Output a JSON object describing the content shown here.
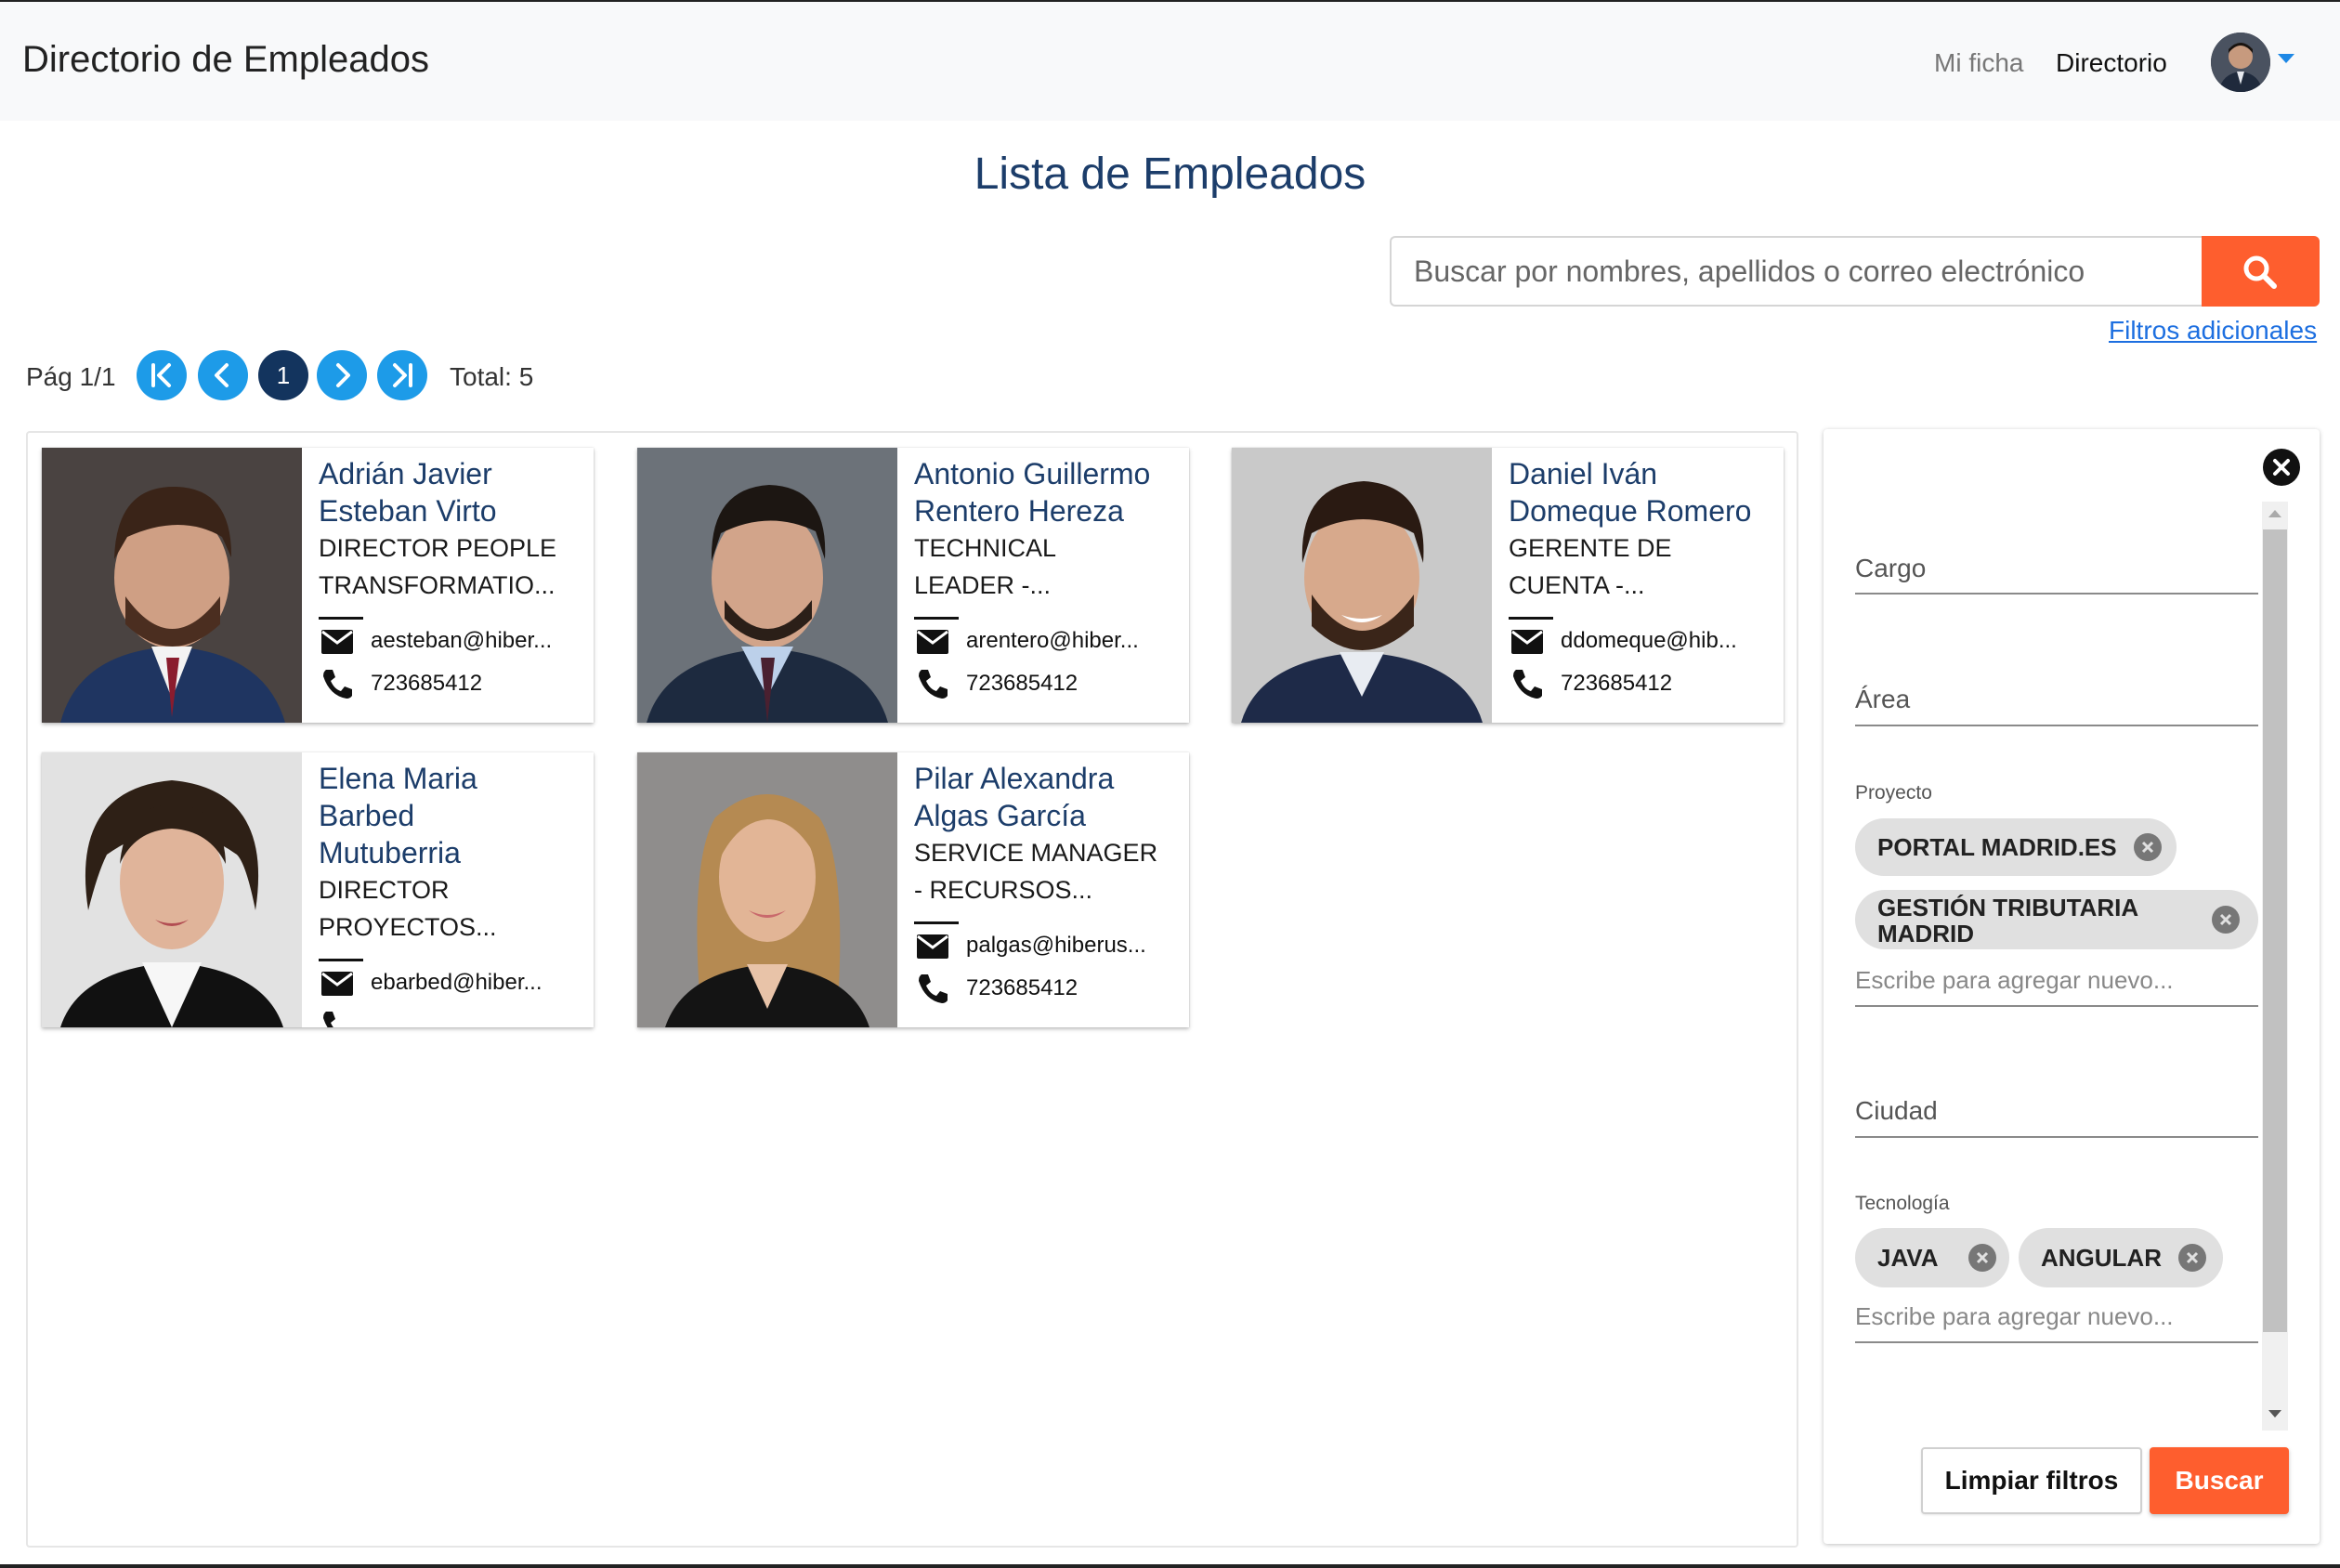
{
  "navbar": {
    "brand": "Directorio de Empleados",
    "links": [
      "Mi ficha",
      "Directorio"
    ]
  },
  "page_title": "Lista de Empleados",
  "search": {
    "placeholder": "Buscar por nombres, apellidos o correo electrónico",
    "value": "",
    "advanced_link": "Filtros adicionales"
  },
  "pagination": {
    "label": "Pág 1/1",
    "current_page": "1",
    "total": "Total: 5"
  },
  "employees": [
    {
      "name_lines": [
        "Adrián Javier",
        "Esteban Virto"
      ],
      "role_lines": [
        "DIRECTOR PEOPLE",
        "TRANSFORMATIO..."
      ],
      "email": "aesteban@hiber...",
      "phone": "723685412"
    },
    {
      "name_lines": [
        "Antonio Guillermo",
        "Rentero Hereza"
      ],
      "role_lines": [
        "TECHNICAL",
        "LEADER -..."
      ],
      "email": "arentero@hiber...",
      "phone": "723685412"
    },
    {
      "name_lines": [
        "Daniel Iván",
        "Domeque Romero"
      ],
      "role_lines": [
        "GERENTE DE",
        "CUENTA -..."
      ],
      "email": "ddomeque@hib...",
      "phone": "723685412"
    },
    {
      "name_lines": [
        "Elena Maria",
        "Barbed",
        "Mutuberria"
      ],
      "role_lines": [
        "DIRECTOR",
        "PROYECTOS..."
      ],
      "email": "ebarbed@hiber...",
      "phone": ""
    },
    {
      "name_lines": [
        "Pilar Alexandra",
        "Algas García"
      ],
      "role_lines": [
        "SERVICE MANAGER",
        "- RECURSOS..."
      ],
      "email": "palgas@hiberus...",
      "phone": "723685412"
    }
  ],
  "filters": {
    "cargo_label": "Cargo",
    "area_label": "Área",
    "proyecto_label": "Proyecto",
    "proyecto_chips": [
      "PORTAL MADRID.ES",
      "GESTIÓN TRIBUTARIA",
      "MADRID"
    ],
    "proyecto_placeholder": "Escribe para agregar nuevo...",
    "ciudad_label": "Ciudad",
    "tecnologia_label": "Tecnología",
    "tecnologia_chips": [
      "JAVA",
      "ANGULAR"
    ],
    "tecnologia_placeholder": "Escribe para agregar nuevo...",
    "clear_button": "Limpiar filtros",
    "search_button": "Buscar"
  },
  "colors": {
    "accent": "#fe5e2e",
    "primary_text": "#1c3d6a",
    "pager_blue": "#1d9be8",
    "pager_current": "#13345e"
  },
  "icons": [
    "user-avatar-icon",
    "search-icon",
    "first-page-icon",
    "prev-page-icon",
    "next-page-icon",
    "last-page-icon",
    "mail-icon",
    "phone-icon",
    "close-icon",
    "chip-remove-icon"
  ]
}
